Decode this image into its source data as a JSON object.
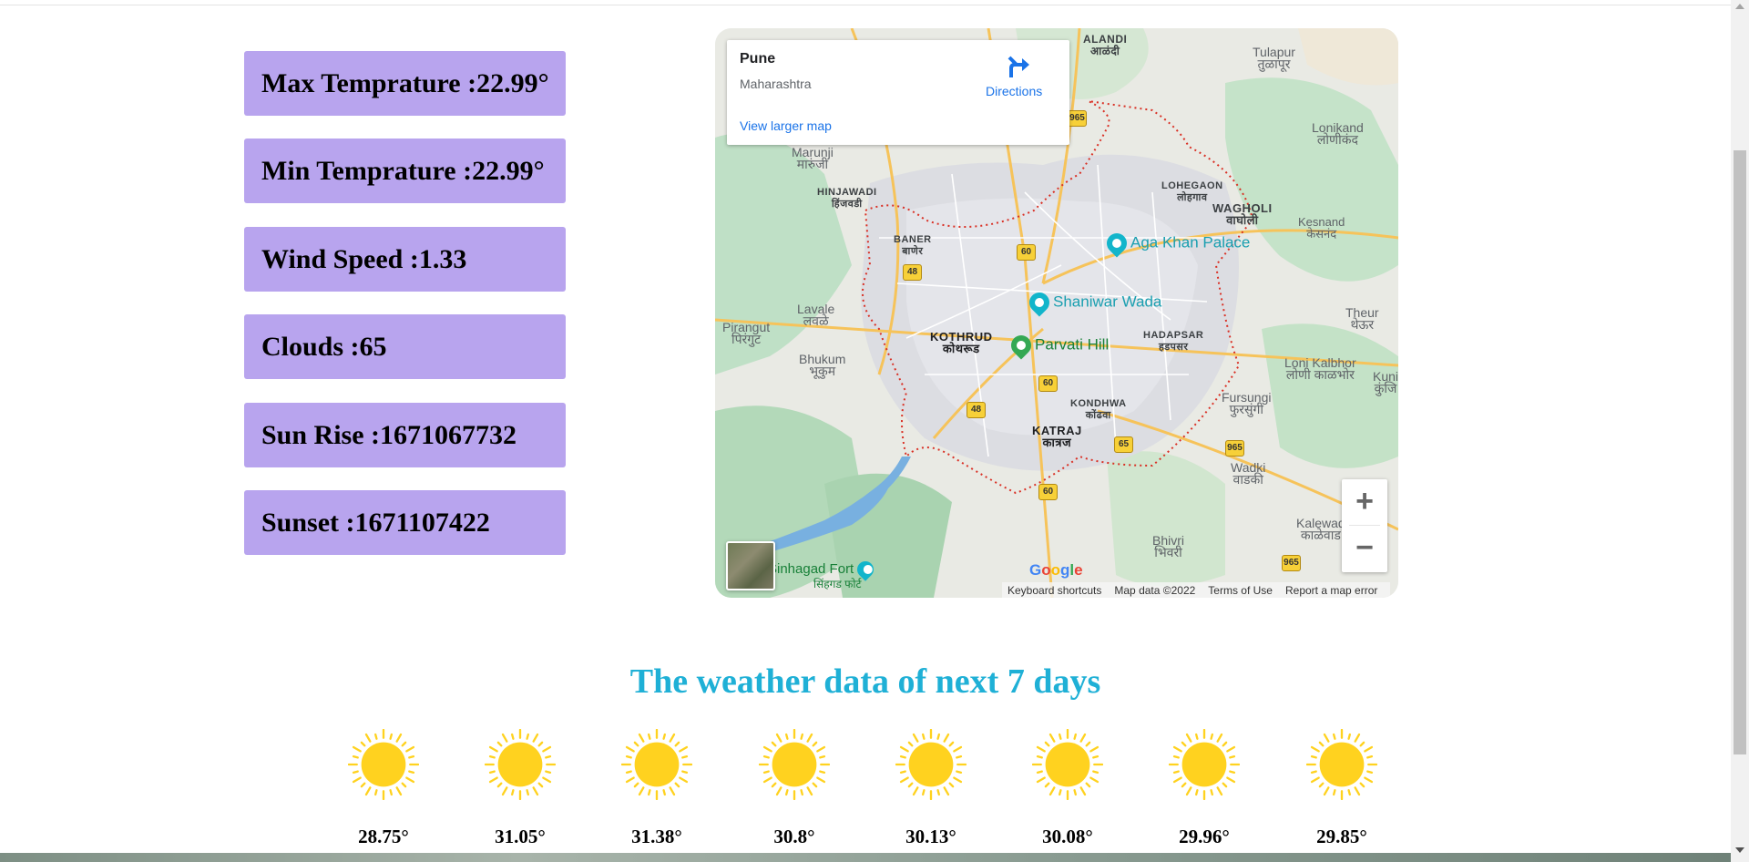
{
  "stats": {
    "max_temp": "Max Temprature :22.99°",
    "min_temp": "Min Temprature :22.99°",
    "wind_speed": "Wind Speed :1.33",
    "clouds": "Clouds :65",
    "sun_rise": "Sun Rise :1671067732",
    "sunset": "Sunset :1671107422"
  },
  "map": {
    "place_name": "Pune",
    "region": "Maharashtra",
    "directions_label": "Directions",
    "view_larger_label": "View larger map",
    "zoom_in": "+",
    "zoom_out": "−",
    "footer": {
      "shortcuts": "Keyboard shortcuts",
      "map_data": "Map data ©2022",
      "terms": "Terms of Use",
      "report": "Report a map error"
    },
    "logo": "Google",
    "pois": {
      "aga_khan": "Aga Khan Palace",
      "shaniwar": "Shaniwar Wada",
      "parvati": "Parvati Hill",
      "sinhagad": "Sinhagad Fort",
      "sinhagad_mr": "सिंहगड फोर्ट"
    },
    "places": [
      {
        "en": "ALANDI",
        "mr": "आळंदी"
      },
      {
        "en": "Tulapur",
        "mr": "तुळापूर"
      },
      {
        "en": "Lonikand",
        "mr": "लोणीकंद"
      },
      {
        "en": "Marunji",
        "mr": "मारुंजी"
      },
      {
        "en": "HINJAWADI",
        "mr": "हिंजवडी"
      },
      {
        "en": "LOHEGAON",
        "mr": "लोहगाव"
      },
      {
        "en": "WAGHOLI",
        "mr": "वाघोली"
      },
      {
        "en": "Kesnand",
        "mr": "केसनंद"
      },
      {
        "en": "BANER",
        "mr": "बाणेर"
      },
      {
        "en": "Lavale",
        "mr": "लवळे"
      },
      {
        "en": "Pirangut",
        "mr": "पिरंगुट"
      },
      {
        "en": "Theur",
        "mr": "थेऊर"
      },
      {
        "en": "KOTHRUD",
        "mr": "कोथरूड"
      },
      {
        "en": "HADAPSAR",
        "mr": "हडपसर"
      },
      {
        "en": "Bhukum",
        "mr": "भूकुम"
      },
      {
        "en": "Loni Kalbhor",
        "mr": "लोणी काळभोर"
      },
      {
        "en": "KONDHWA",
        "mr": "कोंढवा"
      },
      {
        "en": "Fursungi",
        "mr": "फुरसुंगी"
      },
      {
        "en": "KATRAJ",
        "mr": "कात्रज"
      },
      {
        "en": "Wadki",
        "mr": "वाडकी"
      },
      {
        "en": "Kalewad",
        "mr": "काळेवाड"
      },
      {
        "en": "Bhivri",
        "mr": "भिवरी"
      },
      {
        "en": "Kuni",
        "mr": "कुंजि"
      }
    ],
    "road_numbers": [
      "965",
      "60",
      "48",
      "60",
      "60",
      "48",
      "65",
      "965",
      "60",
      "965"
    ]
  },
  "forecast": {
    "heading": "The weather data of next 7 days",
    "icon": "sun-icon",
    "temps": [
      "28.75°",
      "31.05°",
      "31.38°",
      "30.8°",
      "30.13°",
      "30.08°",
      "29.96°",
      "29.85°"
    ]
  },
  "colors": {
    "stat_bg": "#b8a4ee",
    "heading": "#1fb0d6",
    "sun": "#ffd21f"
  }
}
